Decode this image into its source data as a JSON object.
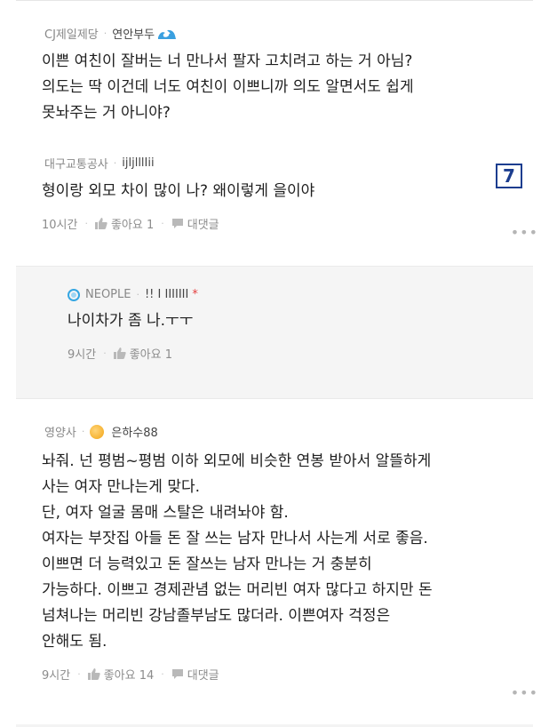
{
  "comments": [
    {
      "org": "CJ제일제당",
      "user": "연안부두",
      "text": "이쁜 여친이 잘버는 너 만나서 팔자 고치려고 하는 거 아님?\n의도는 딱 이건데 너도 여친이 이쁘니까 의도 알면서도 쉽게\n못놔주는 거 아니야?"
    },
    {
      "org": "대구교통공사",
      "user": "ijljlllIii",
      "text": "형이랑 외모 차이 많이 나? 왜이렇게 을이야",
      "time": "10시간",
      "like_label": "좋아요 1",
      "reply_label": "대댓글"
    },
    {
      "org": "NEOPLE",
      "user": "!! I IIIIIII",
      "text": "나이차가 좀 나.ㅜㅜ",
      "time": "9시간",
      "like_label": "좋아요 1"
    },
    {
      "org": "영양사",
      "user": "은하수88",
      "text": "놔줘. 넌 평범~평범 이하 외모에 비슷한 연봉 받아서 알뜰하게\n사는 여자 만나는게 맞다.\n단, 여자 얼굴 몸매 스탈은 내려놔야 함.\n여자는 부잣집 아들 돈 잘 쓰는 남자 만나서 사는게 서로 좋음.\n이쁘면 더 능력있고 돈 잘쓰는 남자 만나는 거 충분히\n가능하다. 이쁘고 경제관념 없는 머리빈 여자 많다고 하지만 돈\n넘쳐나는 머리빈 강남졸부남도 많더라. 이쁜여자 걱정은\n안해도 됨.",
      "time": "9시간",
      "like_label": "좋아요 14",
      "reply_label": "대댓글"
    }
  ],
  "badge": "7",
  "more_glyph": "•••",
  "sep_glyph": "·",
  "author_mark": "*",
  "icons": {
    "wave": "wave-emoji-icon",
    "like": "thumbs-up-icon",
    "reply": "speech-bubble-icon",
    "neople": "neople-avatar-icon",
    "orange": "orange-avatar-icon"
  },
  "colors": {
    "badge_border": "#1b3d8f",
    "reply_bg": "#f5f5f5",
    "meta_text": "#888888",
    "red_star": "#e43f3f"
  }
}
